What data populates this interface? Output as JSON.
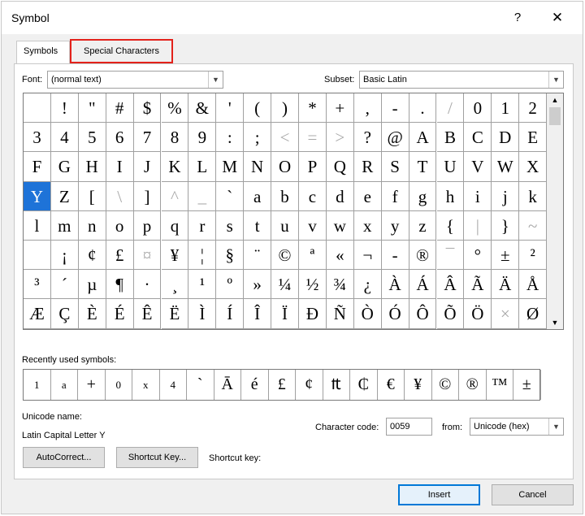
{
  "title": "Symbol",
  "help_glyph": "?",
  "close_glyph": "✕",
  "tabs": {
    "symbols": "Symbols",
    "special": "Special Characters"
  },
  "font": {
    "label": "Font:",
    "value": "(normal text)"
  },
  "subset": {
    "label": "Subset:",
    "value": "Basic Latin"
  },
  "grid": {
    "selected": "Y",
    "selected_bg": "#1e73d8",
    "cells": [
      "",
      "!",
      "\"",
      "#",
      "$",
      "%",
      "&",
      "'",
      "(",
      ")",
      "*",
      "+",
      ",",
      "-",
      ".",
      "/",
      "0",
      "1",
      "2",
      "3",
      "4",
      "5",
      "6",
      "7",
      "8",
      "9",
      ":",
      ";",
      "<",
      "=",
      ">",
      "?",
      "@",
      "A",
      "B",
      "C",
      "D",
      "E",
      "F",
      "G",
      "H",
      "I",
      "J",
      "K",
      "L",
      "M",
      "N",
      "O",
      "P",
      "Q",
      "R",
      "S",
      "T",
      "U",
      "V",
      "W",
      "X",
      "Y",
      "Z",
      "[",
      "\\",
      "]",
      "^",
      "_",
      "`",
      "a",
      "b",
      "c",
      "d",
      "e",
      "f",
      "g",
      "h",
      "i",
      "j",
      "k",
      "l",
      "m",
      "n",
      "o",
      "p",
      "q",
      "r",
      "s",
      "t",
      "u",
      "v",
      "w",
      "x",
      "y",
      "z",
      "{",
      "|",
      "}",
      "~",
      "",
      "¡",
      "¢",
      "£",
      "¤",
      "¥",
      "¦",
      "§",
      "¨",
      "©",
      "ª",
      "«",
      "¬",
      "-",
      "®",
      "¯",
      "°",
      "±",
      "²",
      "³",
      "´",
      "µ",
      "¶",
      "·",
      "¸",
      "¹",
      "º",
      "»",
      "¼",
      "½",
      "¾",
      "¿",
      "À",
      "Á",
      "Â",
      "Ã",
      "Ä",
      "Å",
      "Æ",
      "Ç",
      "È",
      "É",
      "Ê",
      "Ë",
      "Ì",
      "Í",
      "Î",
      "Ï",
      "Ð",
      "Ñ",
      "Ò",
      "Ó",
      "Ô",
      "Õ",
      "Ö",
      "×",
      "Ø"
    ],
    "faded": [
      "\\",
      "^",
      "_",
      "<",
      "=",
      ">",
      "/",
      "|",
      "~",
      "¤",
      "×",
      "¯"
    ]
  },
  "recent": {
    "label": "Recently used symbols:",
    "symbols": [
      "1",
      "a",
      "+",
      "0",
      "x",
      "4",
      "`",
      "Ā",
      "é",
      "£",
      "¢",
      "₶",
      "₵",
      "€",
      "¥",
      "©",
      "®",
      "™",
      "±"
    ]
  },
  "unicode_name": {
    "label": "Unicode name:",
    "value": "Latin Capital Letter Y"
  },
  "char_code": {
    "label": "Character code:",
    "value": "0059"
  },
  "from": {
    "label": "from:",
    "value": "Unicode (hex)"
  },
  "buttons": {
    "autocorrect": "AutoCorrect...",
    "shortcut_key": "Shortcut Key...",
    "insert": "Insert",
    "cancel": "Cancel"
  },
  "shortcut_key_label": "Shortcut key:",
  "colors": {
    "highlight_border": "#e3221b",
    "primary_border": "#0078d7"
  }
}
